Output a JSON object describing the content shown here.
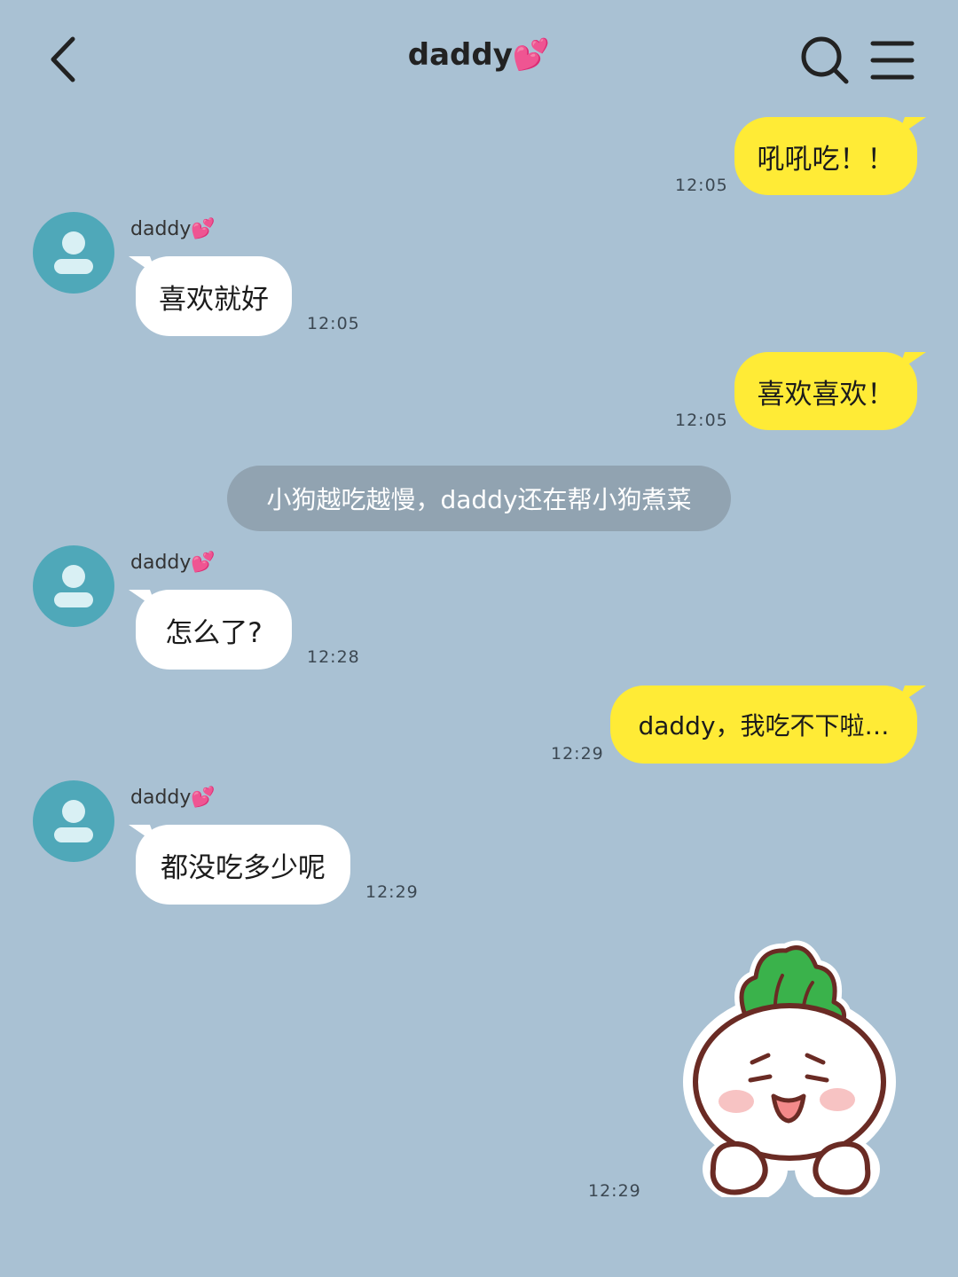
{
  "header": {
    "title": "daddy💕",
    "back_icon": "chevron-left-icon",
    "search_icon": "search-icon",
    "menu_icon": "menu-icon"
  },
  "colors": {
    "background": "#a9c1d3",
    "outgoing_bubble": "#ffeb36",
    "incoming_bubble": "#ffffff",
    "avatar": "#4fa8b9",
    "system_bubble": "#91a3b1"
  },
  "messages": [
    {
      "side": "out",
      "text": "吼吼吃！！",
      "time": "12:05"
    },
    {
      "side": "in",
      "sender": "daddy💕",
      "text": "喜欢就好",
      "time": "12:05"
    },
    {
      "side": "out",
      "text": "喜欢喜欢！",
      "time": "12:05"
    },
    {
      "side": "system",
      "text": "小狗越吃越慢，daddy还在帮小狗煮菜"
    },
    {
      "side": "in",
      "sender": "daddy💕",
      "text": "怎么了?",
      "time": "12:28"
    },
    {
      "side": "out",
      "text": "daddy，我吃不下啦…",
      "time": "12:29"
    },
    {
      "side": "in",
      "sender": "daddy💕",
      "text": "都没吃多少呢",
      "time": "12:29"
    },
    {
      "side": "out",
      "type": "sticker",
      "sticker": "turnip-sticker",
      "time": "12:29"
    }
  ]
}
